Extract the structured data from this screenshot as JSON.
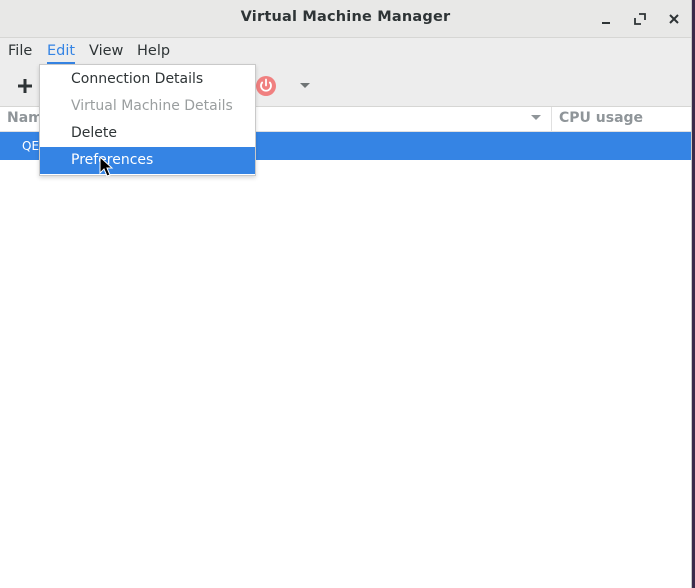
{
  "window": {
    "title": "Virtual Machine Manager"
  },
  "titlebar_buttons": [
    {
      "name": "minimize",
      "icon": "minimize-icon"
    },
    {
      "name": "maximize",
      "icon": "maximize-icon"
    },
    {
      "name": "close",
      "icon": "close-icon"
    }
  ],
  "menubar": {
    "items": [
      {
        "label": "File"
      },
      {
        "label": "Edit"
      },
      {
        "label": "View"
      },
      {
        "label": "Help"
      }
    ],
    "open_menu": "Edit"
  },
  "toolbar": {
    "buttons": [
      {
        "icon": "plus-icon"
      },
      {
        "icon": "power-icon"
      },
      {
        "icon": "chevron-down-icon"
      }
    ]
  },
  "list": {
    "columns": [
      {
        "label": "Nam"
      },
      {
        "label": "CPU usage"
      }
    ],
    "rows": [
      {
        "text": "QE",
        "selected": true
      }
    ]
  },
  "edit_menu": {
    "items": [
      {
        "label": "Connection Details",
        "state": "enabled"
      },
      {
        "label": "Virtual Machine Details",
        "state": "disabled"
      },
      {
        "label": "Delete",
        "state": "enabled"
      },
      {
        "label": "Preferences",
        "state": "highlighted"
      }
    ]
  },
  "colors": {
    "accent": "#3584e4",
    "power_button": "#f08080",
    "background": "#ffffff"
  }
}
